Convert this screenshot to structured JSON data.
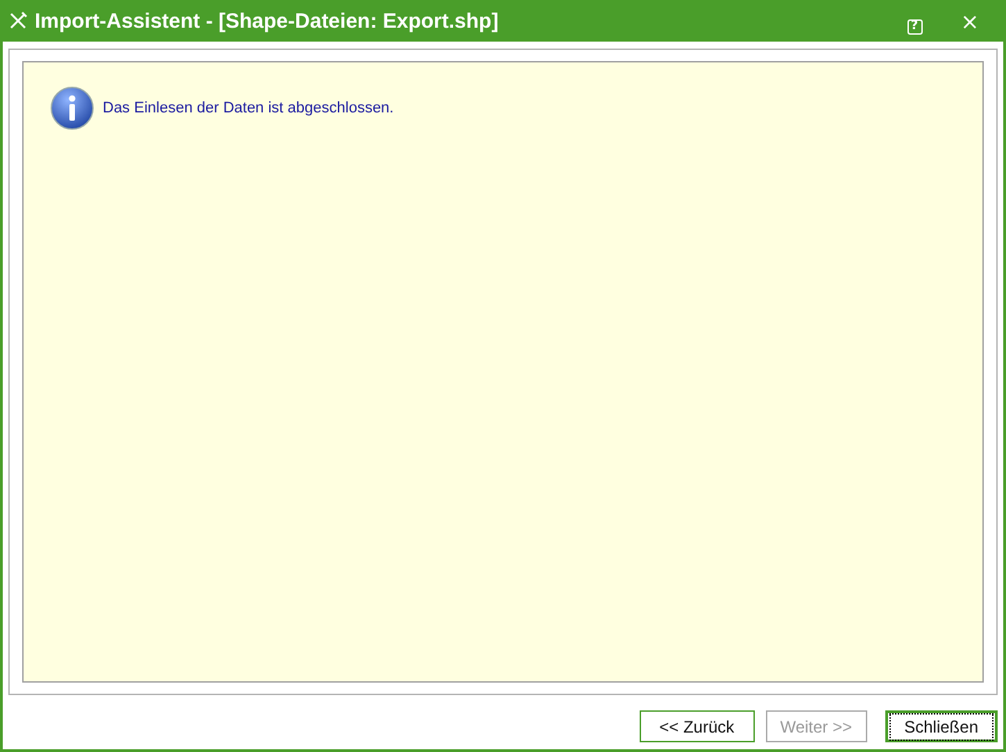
{
  "window": {
    "title": "Import-Assistent - [Shape-Dateien: Export.shp]",
    "help_button": "?",
    "close_button": "×"
  },
  "message": {
    "text": "Das Einlesen der Daten ist abgeschlossen."
  },
  "buttons": [
    {
      "label": "<<  Zurück",
      "disabled": false,
      "focused": false
    },
    {
      "label": "Weiter  >>",
      "disabled": true,
      "focused": false
    },
    {
      "label": "Schließen",
      "disabled": false,
      "focused": true
    }
  ]
}
